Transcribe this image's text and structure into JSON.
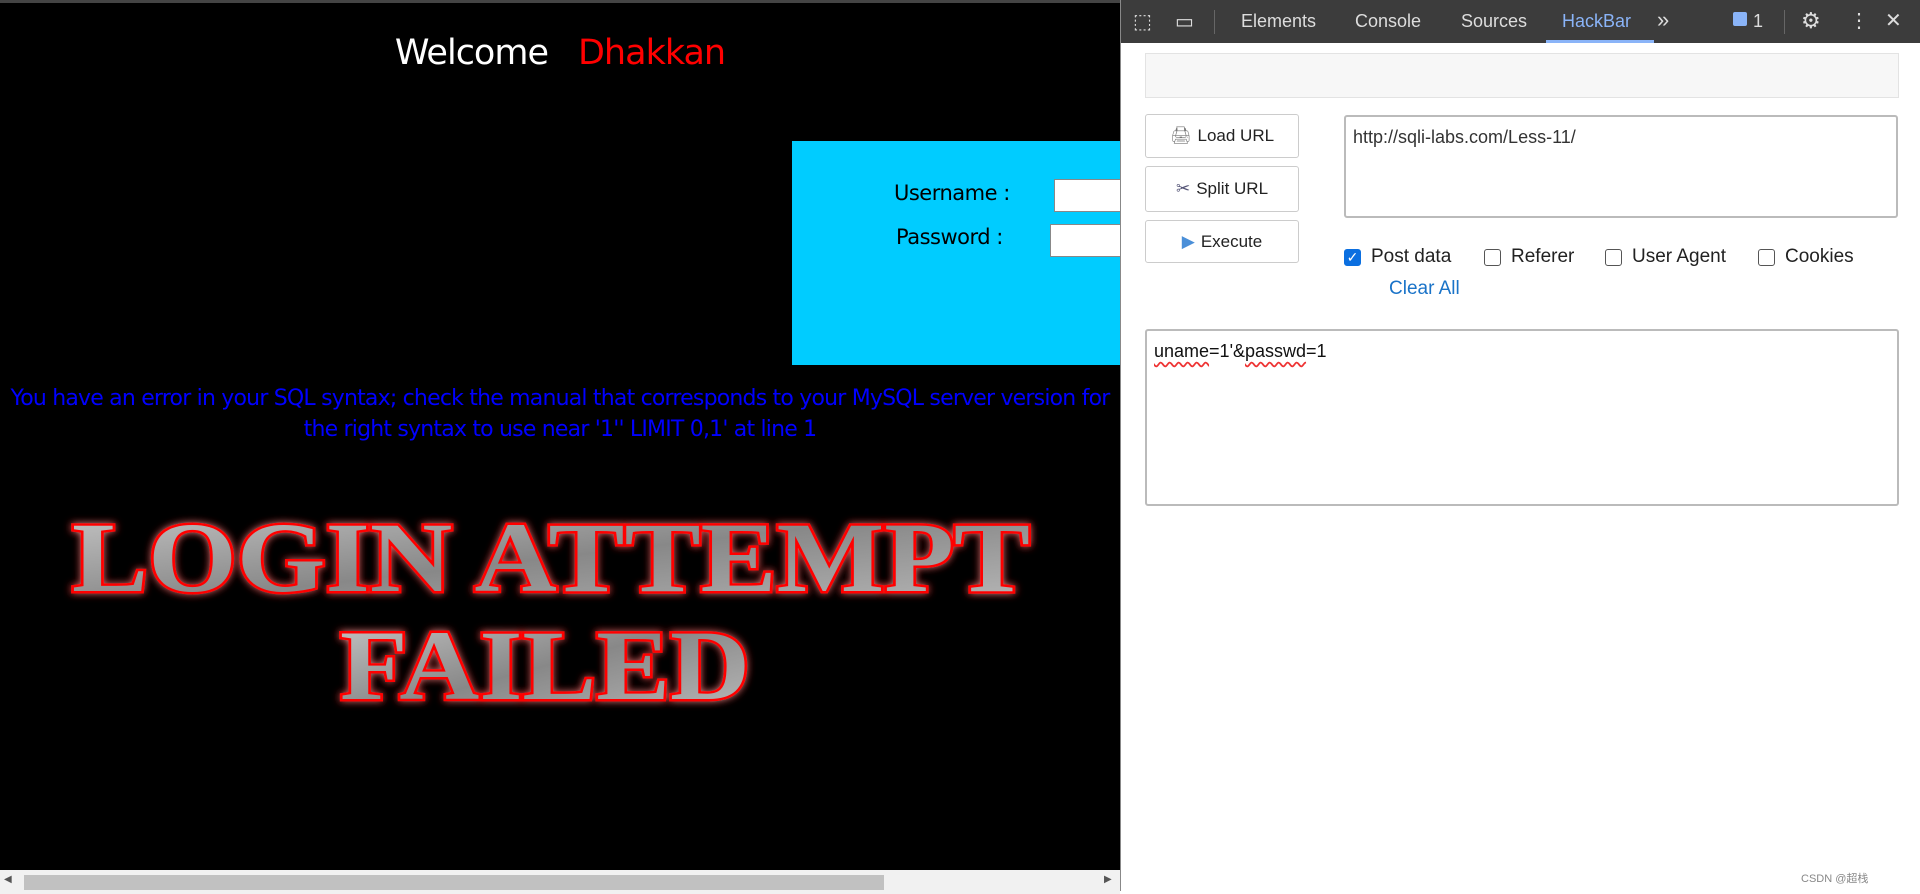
{
  "page": {
    "welcome": "Welcome",
    "username": "Dhakkan",
    "username_label": "Username :",
    "password_label": "Password :",
    "error": "You have an error in your SQL syntax; check the manual that corresponds to your MySQL server version for the right syntax to use near '1'' LIMIT 0,1' at line 1",
    "banner_line1": "LOGIN ATTEMPT",
    "banner_line2": "FAILED"
  },
  "devtools": {
    "tabs": [
      "Elements",
      "Console",
      "Sources",
      "HackBar"
    ],
    "active_tab": "HackBar",
    "more": "»",
    "issues_count": "1",
    "accent": "#8ab4f8"
  },
  "hackbar": {
    "load_url": "Load URL",
    "split_url": "Split URL",
    "execute": "Execute",
    "url": "http://sqli-labs.com/Less-11/",
    "options": [
      {
        "label": "Post data",
        "checked": true
      },
      {
        "label": "Referer",
        "checked": false
      },
      {
        "label": "User Agent",
        "checked": false
      },
      {
        "label": "Cookies",
        "checked": false
      }
    ],
    "clear_all": "Clear All",
    "post_a": "uname",
    "post_b": "=1'&",
    "post_c": "passwd",
    "post_d": "=1"
  },
  "watermark": "CSDN @超栈"
}
